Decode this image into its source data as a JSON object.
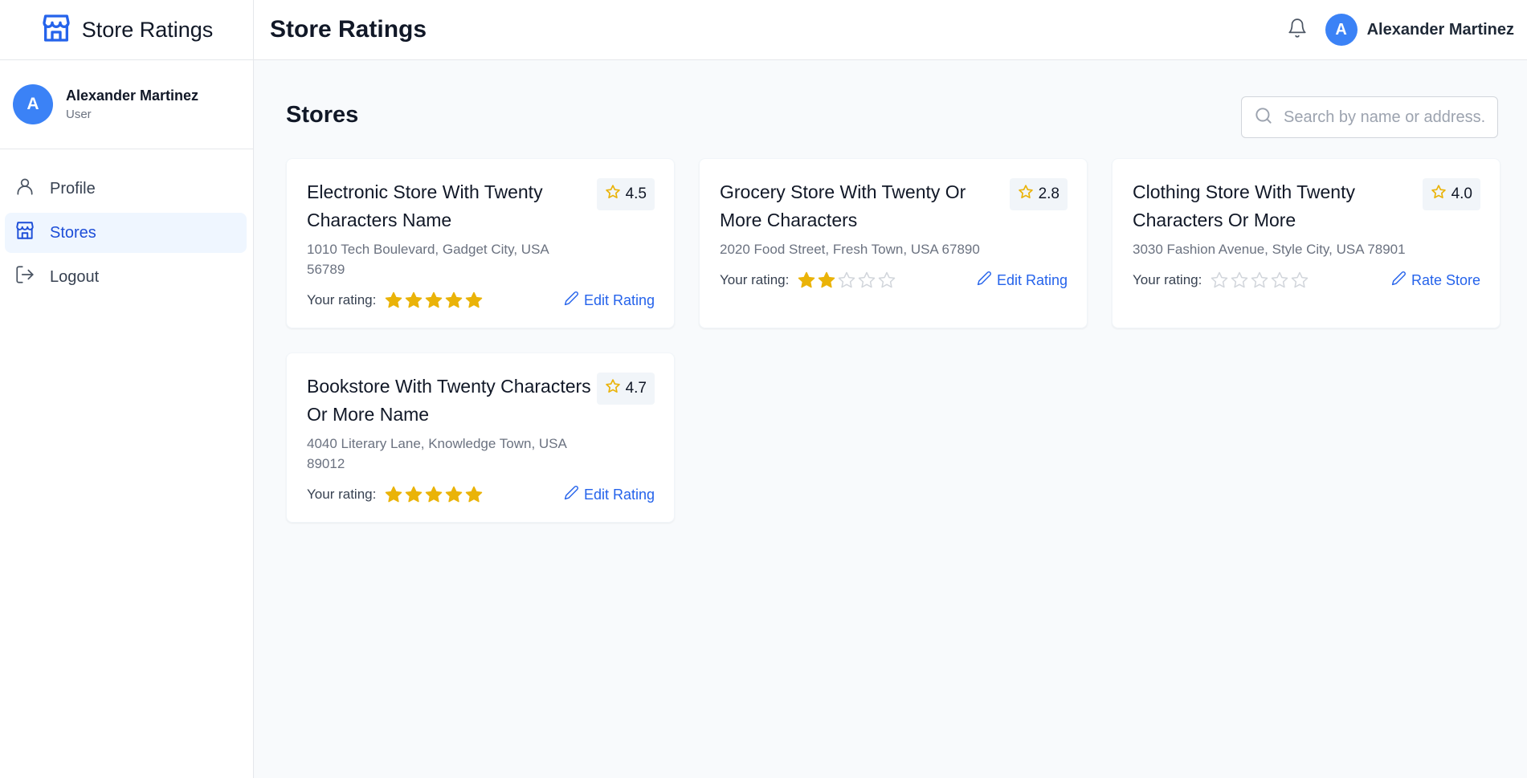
{
  "brand": {
    "title": "Store Ratings",
    "icon": "store-icon",
    "accent": "#2563eb"
  },
  "sidebar": {
    "user": {
      "initial": "A",
      "name": "Alexander Martinez",
      "role": "User"
    },
    "nav": [
      {
        "label": "Profile",
        "icon": "user-icon",
        "active": false
      },
      {
        "label": "Stores",
        "icon": "store-icon",
        "active": true
      },
      {
        "label": "Logout",
        "icon": "logout-icon",
        "active": false
      }
    ]
  },
  "header": {
    "title": "Store Ratings",
    "user": {
      "initial": "A",
      "name": "Alexander Martinez"
    }
  },
  "main": {
    "section_title": "Stores",
    "search": {
      "placeholder": "Search by name or address..",
      "value": ""
    },
    "rating_label": "Your rating:",
    "stores": [
      {
        "name": "Electronic Store With Twenty Characters Name",
        "address": "1010 Tech Boulevard, Gadget City, USA 56789",
        "overall_rating": "4.5",
        "user_rating": 5,
        "action": "Edit Rating"
      },
      {
        "name": "Grocery Store With Twenty Or More Characters",
        "address": "2020 Food Street, Fresh Town, USA 67890",
        "overall_rating": "2.8",
        "user_rating": 2,
        "action": "Edit Rating"
      },
      {
        "name": "Clothing Store With Twenty Characters Or More",
        "address": "3030 Fashion Avenue, Style City, USA 78901",
        "overall_rating": "4.0",
        "user_rating": 0,
        "action": "Rate Store"
      },
      {
        "name": "Bookstore With Twenty Characters Or More Name",
        "address": "4040 Literary Lane, Knowledge Town, USA 89012",
        "overall_rating": "4.7",
        "user_rating": 5,
        "action": "Edit Rating"
      }
    ]
  },
  "colors": {
    "star_filled": "#eab308",
    "star_empty": "#d1d5db",
    "link": "#2563eb",
    "avatar": "#3b82f6"
  }
}
